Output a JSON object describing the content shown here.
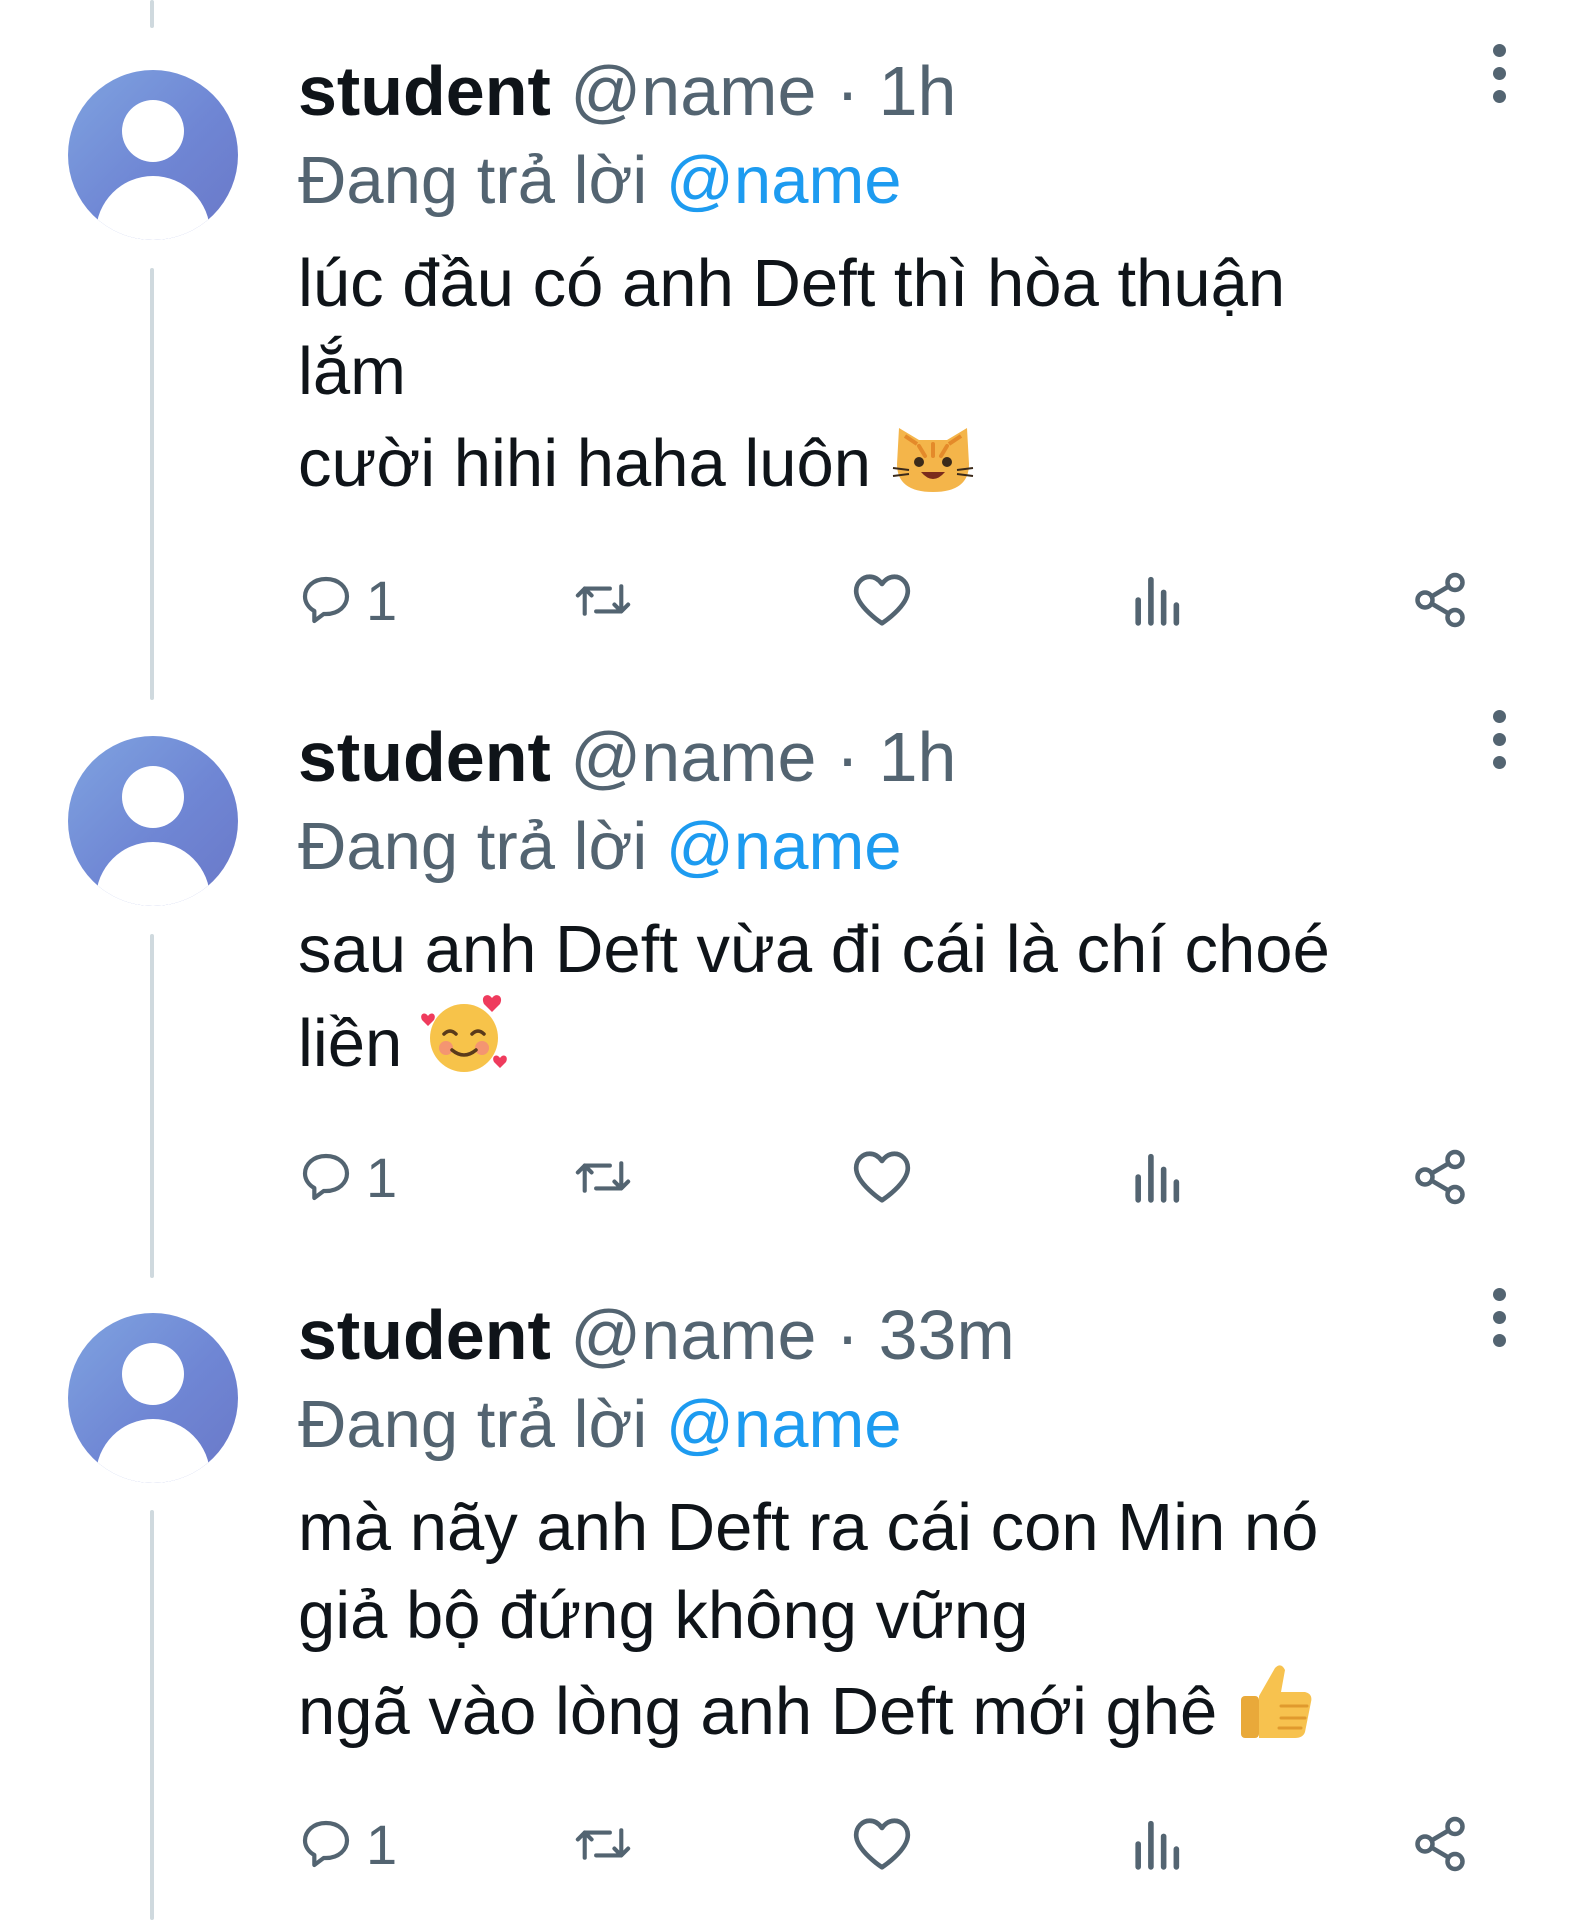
{
  "tweets": [
    {
      "display_name": "student",
      "handle": "@name",
      "separator": "·",
      "time": "1h",
      "reply_prefix": "Đang trả lời",
      "reply_to": "@name",
      "lines": [
        "lúc đầu có anh Deft thì hòa thuận",
        "lắm",
        "cười hihi haha luôn"
      ],
      "emoji": "smiling-cat-emoji",
      "reply_count": "1"
    },
    {
      "display_name": "student",
      "handle": "@name",
      "separator": "·",
      "time": "1h",
      "reply_prefix": "Đang trả lời",
      "reply_to": "@name",
      "lines": [
        "sau anh Deft vừa đi cái là chí choé",
        "liền"
      ],
      "emoji": "smiling-face-with-hearts-emoji",
      "reply_count": "1"
    },
    {
      "display_name": "student",
      "handle": "@name",
      "separator": "·",
      "time": "33m",
      "reply_prefix": "Đang trả lời",
      "reply_to": "@name",
      "lines": [
        "mà nãy anh Deft ra cái con Min nó",
        "giả bộ đứng không vững",
        "ngã vào lòng anh Deft mới ghê"
      ],
      "emoji": "thumbs-up-emoji",
      "reply_count": "1"
    }
  ],
  "colors": {
    "mention": "#1d9bf0",
    "secondary_text": "#536471",
    "primary_text": "#0f1419",
    "avatar": "#6f86d4"
  }
}
